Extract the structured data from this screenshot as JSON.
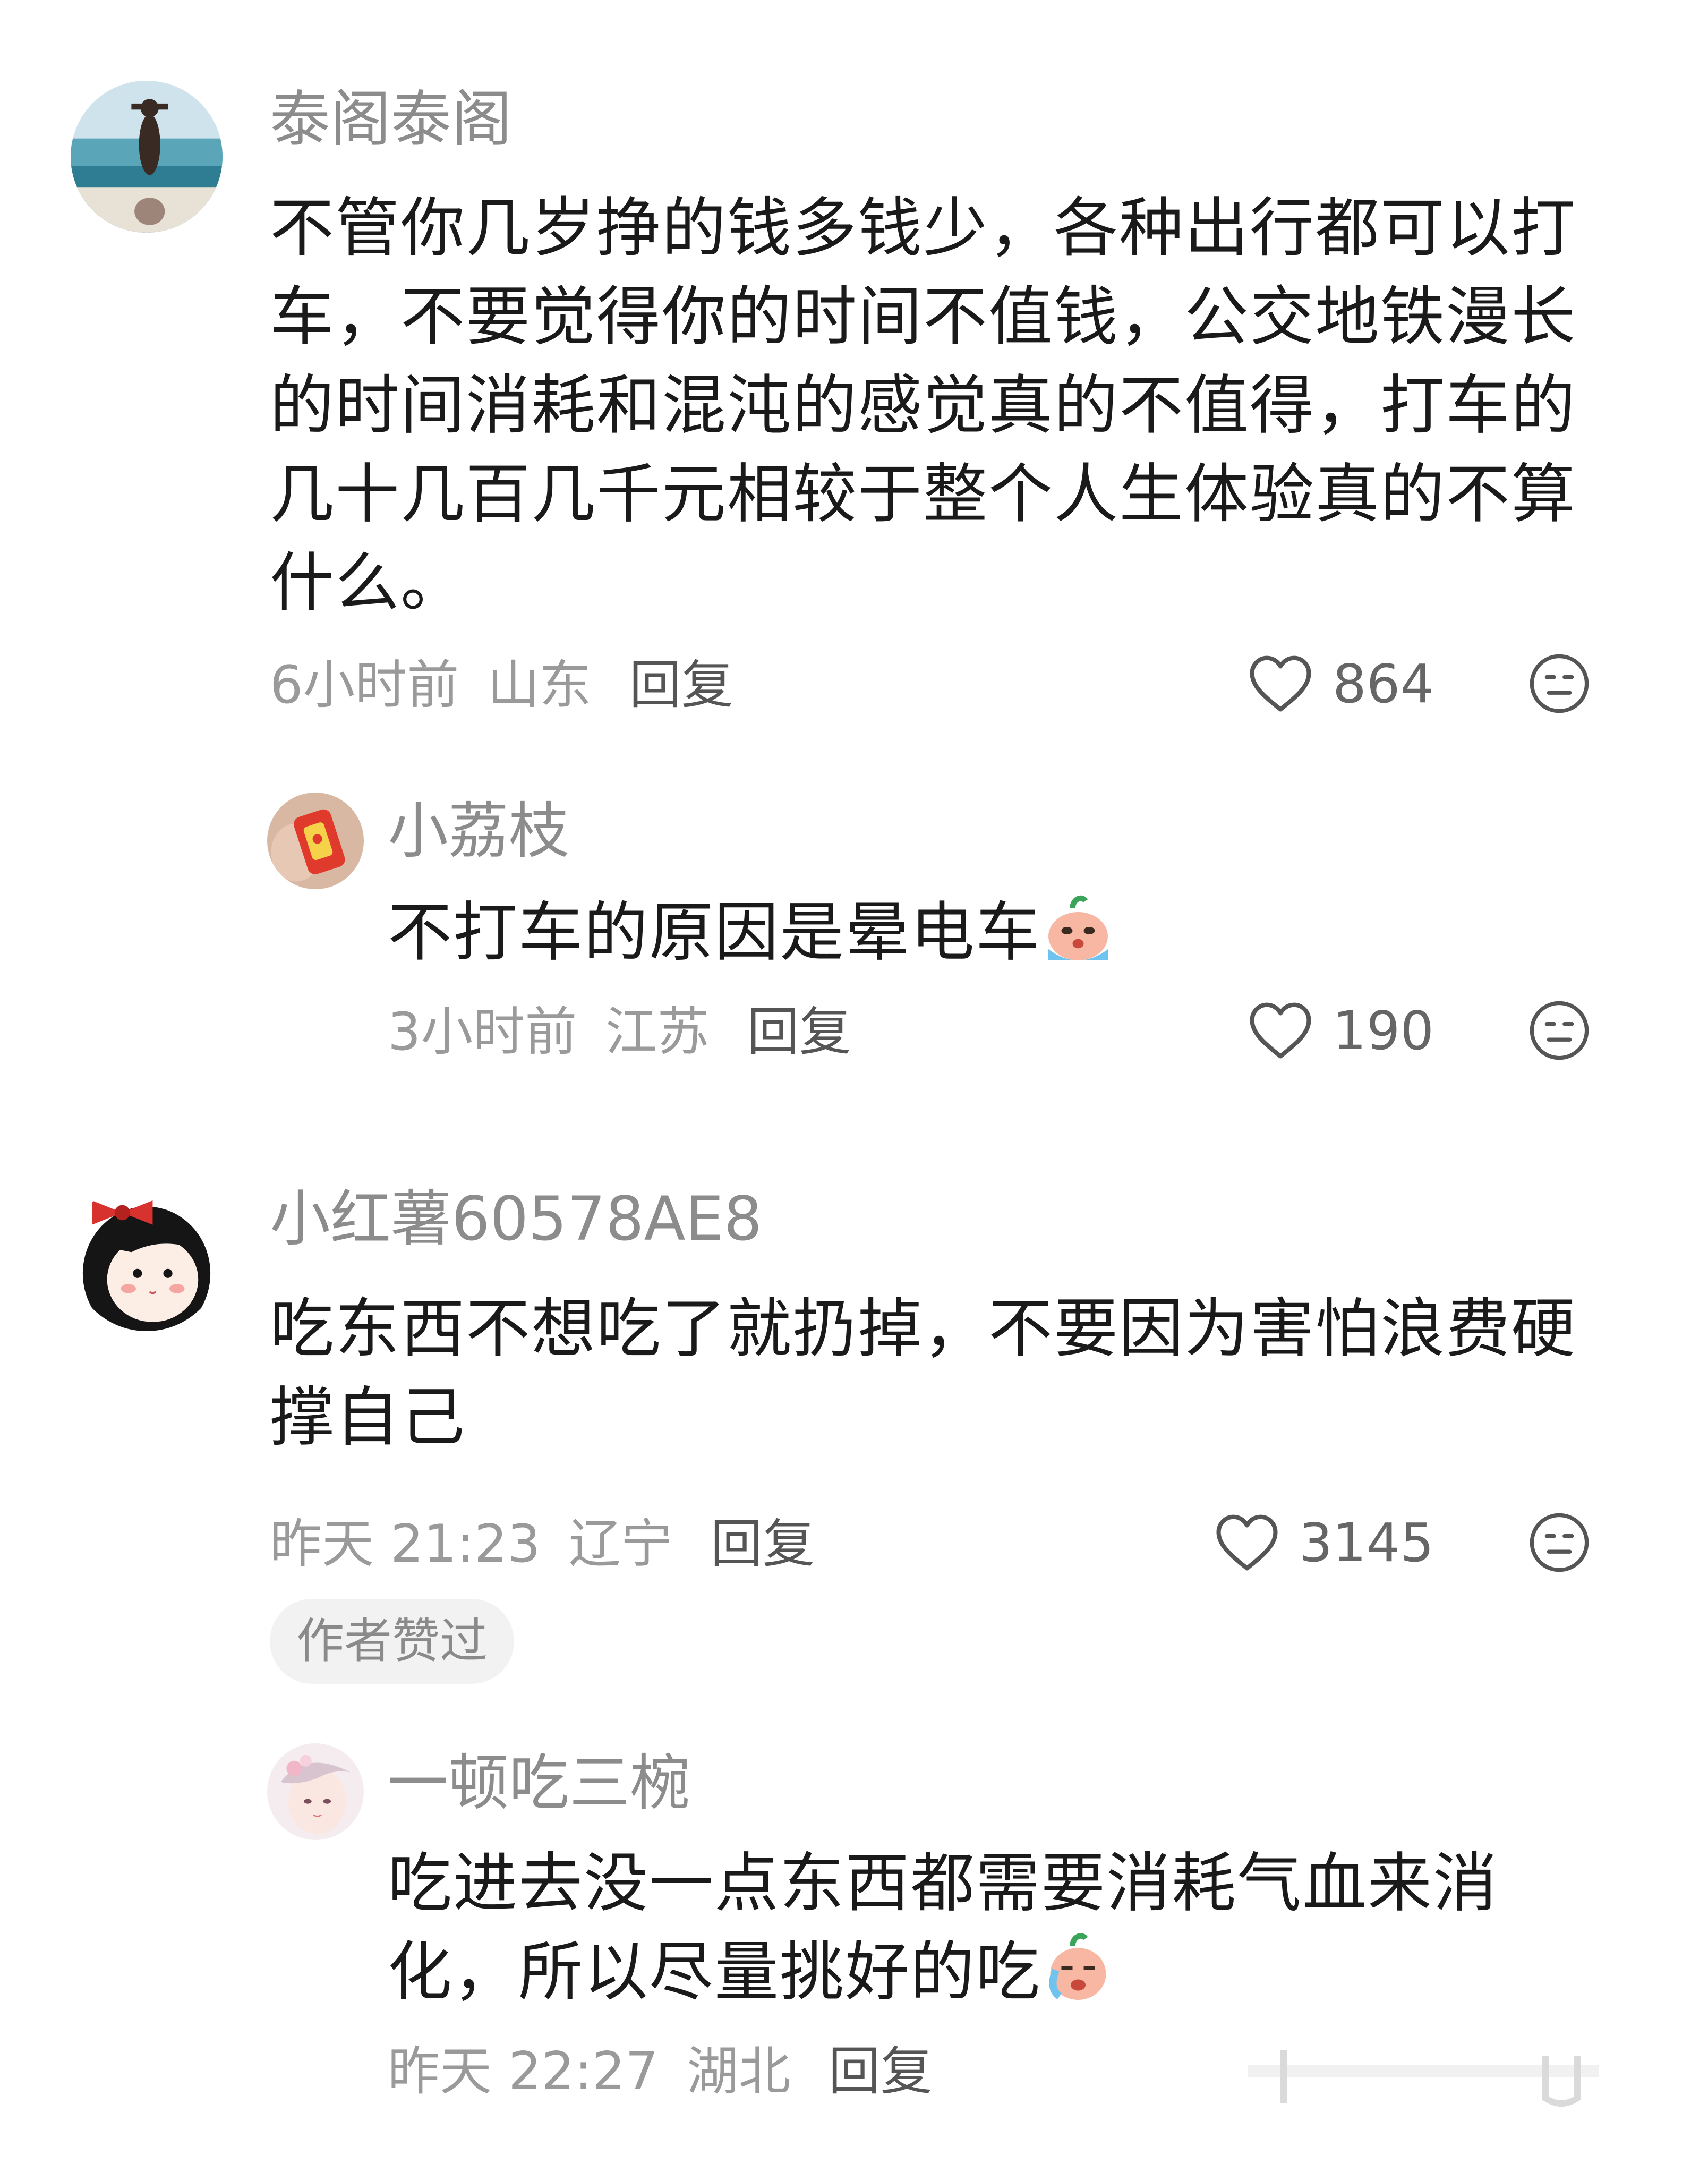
{
  "comments": [
    {
      "username": "泰阁泰阁",
      "content_lines": [
        "不管你几岁挣的钱多钱少，各种出行都可以打",
        "车，不要觉得你的时间不值钱，公交地铁漫长",
        "的时间消耗和混沌的感觉真的不值得，打车的",
        "几十几百几千元相较于整个人生体验真的不算",
        "什么。"
      ],
      "time": "6小时前",
      "location": "山东",
      "reply_label": "回复",
      "likes": "864",
      "avatar_icon": "beach-photo-avatar",
      "replies": [
        {
          "username": "小荔枝",
          "content": "不打车的原因是晕电车",
          "emoji": "crying-face-emoji",
          "time": "3小时前",
          "location": "江苏",
          "reply_label": "回复",
          "likes": "190",
          "avatar_icon": "candy-photo-avatar"
        }
      ]
    },
    {
      "username": "小红薯60578AE8",
      "content_lines": [
        "吃东西不想吃了就扔掉，不要因为害怕浪费硬",
        "撑自己"
      ],
      "time": "昨天 21:23",
      "location": "辽宁",
      "reply_label": "回复",
      "likes": "3145",
      "author_liked": "作者赞过",
      "avatar_icon": "cartoon-girl-avatar",
      "replies": [
        {
          "username": "一顿吃三椀",
          "content_lines": [
            "吃进去没一点东西都需要消耗气血来消",
            "化，所以尽量挑好的吃"
          ],
          "emoji": "crying-face-emoji",
          "time": "昨天 22:27",
          "location": "湖北",
          "reply_label": "回复",
          "avatar_icon": "anime-girl-avatar"
        }
      ]
    }
  ],
  "colors": {
    "username": "#8c8c8c",
    "content": "#1a1a1a",
    "meta": "#9a9a9a",
    "badge_bg": "#f2f2f2"
  }
}
